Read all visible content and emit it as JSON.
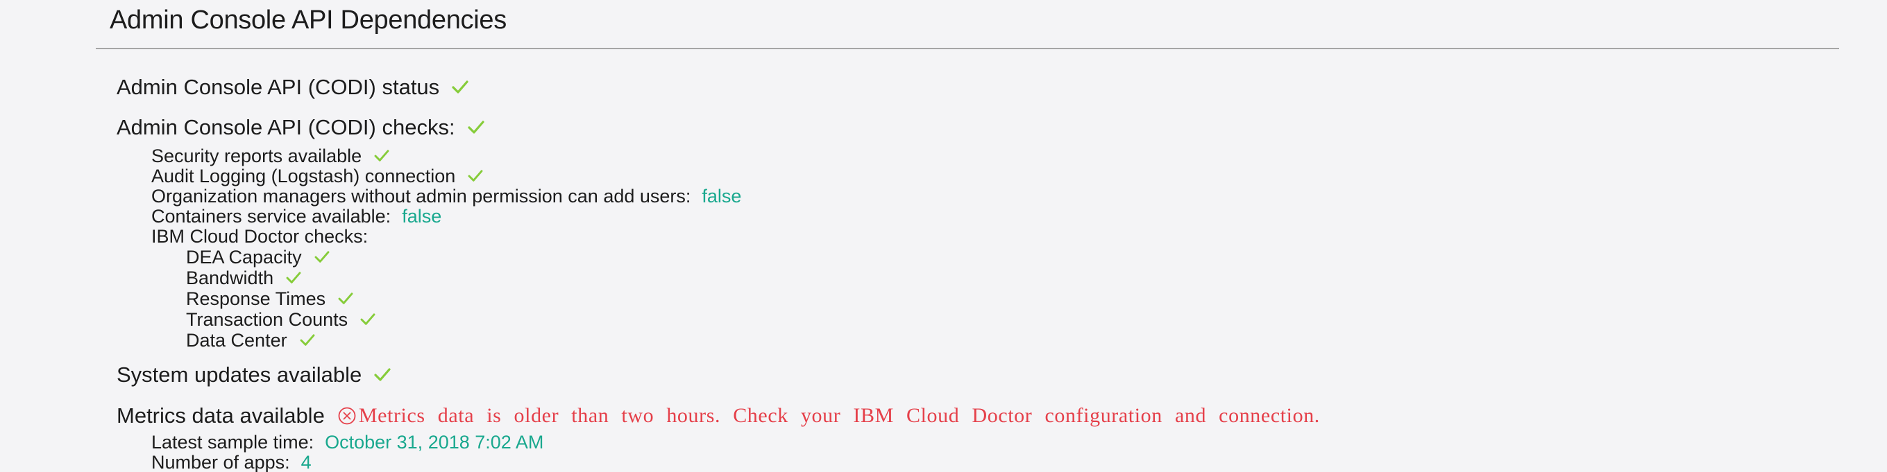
{
  "page": {
    "title": "Admin Console API Dependencies"
  },
  "colors": {
    "check": "#86cc3a",
    "value": "#19a88e",
    "error": "#e5404a",
    "rule": "#a6a6a6"
  },
  "status": {
    "label": "Admin Console API (CODI) status",
    "icon": "check-icon"
  },
  "checks": {
    "label": "Admin Console API (CODI) checks:",
    "icon": "check-icon",
    "items": [
      {
        "label": "Security reports available"
      },
      {
        "label": "Audit Logging (Logstash) connection"
      },
      {
        "label": "Organization managers without admin permission can add users:",
        "value": "false"
      },
      {
        "label": "Containers service available:",
        "value": "false"
      },
      {
        "label": "IBM Cloud Doctor checks:"
      }
    ],
    "doctor": [
      {
        "label": "DEA Capacity"
      },
      {
        "label": "Bandwidth"
      },
      {
        "label": "Response Times"
      },
      {
        "label": "Transaction Counts"
      },
      {
        "label": "Data Center"
      }
    ]
  },
  "updates": {
    "label": "System updates available",
    "icon": "check-icon"
  },
  "metrics": {
    "label": "Metrics data available",
    "error_icon": "error-circle-icon",
    "error_message": "Metrics data is older than two hours. Check your IBM Cloud Doctor configuration and connection.",
    "latest_sample_label": "Latest sample time:",
    "latest_sample_value": "October 31, 2018 7:02 AM",
    "apps_label": "Number of apps:",
    "apps_value": "4"
  }
}
